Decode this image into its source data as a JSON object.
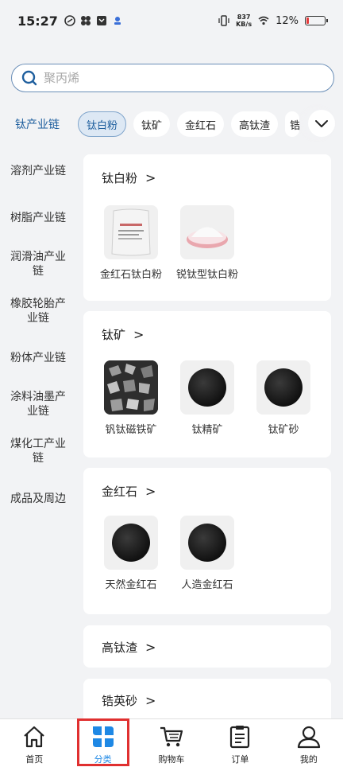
{
  "status_bar": {
    "time": "15:27",
    "net_speed_value": "837",
    "net_speed_unit": "KB/s",
    "battery": "12%",
    "battery_level": 0.12
  },
  "search": {
    "placeholder": "聚丙烯"
  },
  "chain_title": "钛产业链",
  "chips": [
    {
      "label": "钛白粉",
      "active": true
    },
    {
      "label": "钛矿"
    },
    {
      "label": "金红石"
    },
    {
      "label": "高钛渣"
    },
    {
      "label": "锆"
    }
  ],
  "sidebar": [
    "溶剂产业链",
    "树脂产业链",
    "润滑油产业链",
    "橡胶轮胎产业链",
    "粉体产业链",
    "涂料油墨产业链",
    "煤化工产业链",
    "成品及周边"
  ],
  "sections": [
    {
      "title": "钛白粉",
      "arrow": ">",
      "products": [
        "金红石钛白粉",
        "锐钛型钛白粉"
      ]
    },
    {
      "title": "钛矿",
      "arrow": ">",
      "products": [
        "钒钛磁铁矿",
        "钛精矿",
        "钛矿砂"
      ]
    },
    {
      "title": "金红石",
      "arrow": ">",
      "products": [
        "天然金红石",
        "人造金红石"
      ]
    },
    {
      "title": "高钛渣",
      "arrow": ">"
    },
    {
      "title": "锆英砂",
      "arrow": ">"
    }
  ],
  "tabbar": [
    {
      "label": "首页",
      "icon": "home-icon"
    },
    {
      "label": "分类",
      "icon": "category-icon",
      "active": true
    },
    {
      "label": "购物车",
      "icon": "cart-icon"
    },
    {
      "label": "订单",
      "icon": "order-icon"
    },
    {
      "label": "我的",
      "icon": "user-icon"
    }
  ],
  "colors": {
    "accent": "#1e88e5",
    "chain_title": "#1f5f9e",
    "highlight_box": "#e03030"
  }
}
